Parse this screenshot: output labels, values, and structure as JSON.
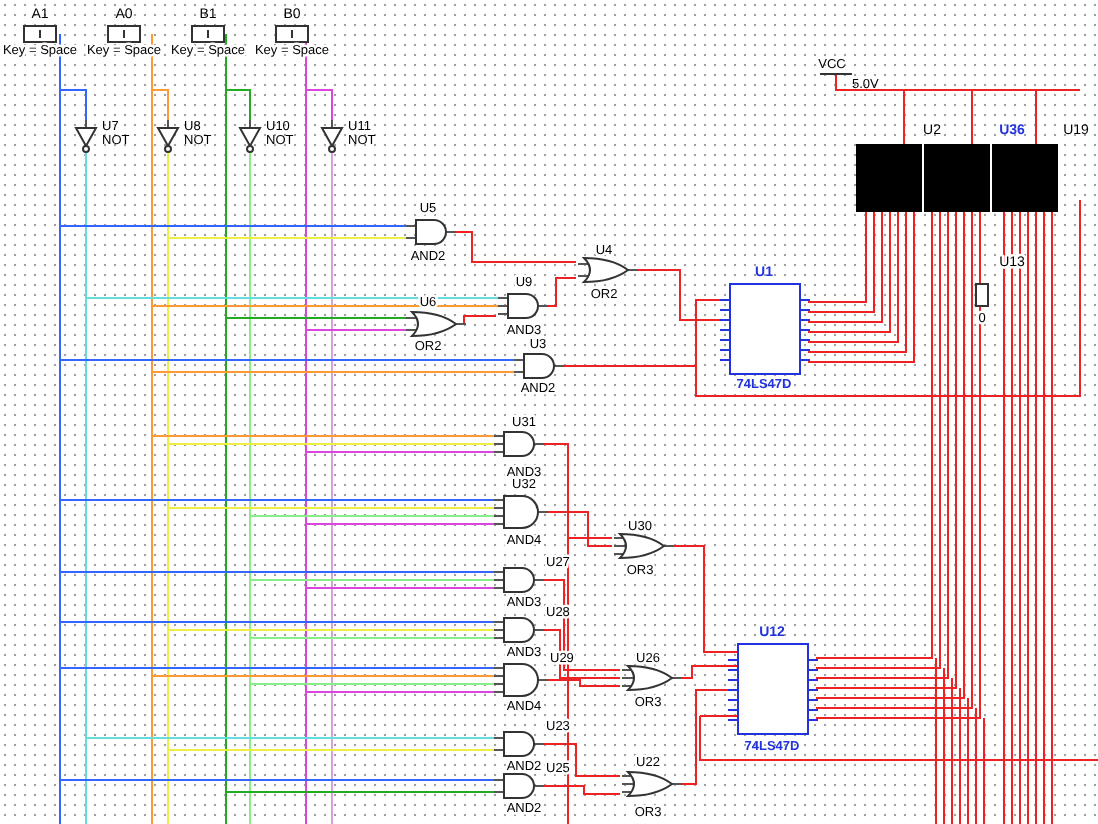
{
  "switches": [
    {
      "label": "A1",
      "key": "Key = Space",
      "color": "#3366ff"
    },
    {
      "label": "A0",
      "key": "Key = Space",
      "color": "#ff9933"
    },
    {
      "label": "B1",
      "key": "Key = Space",
      "color": "#22aa22"
    },
    {
      "label": "B0",
      "key": "Key = Space",
      "color": "#dd44dd"
    }
  ],
  "inverters": [
    {
      "ref": "U7",
      "type": "NOT",
      "color": "#66dddd"
    },
    {
      "ref": "U8",
      "type": "NOT",
      "color": "#eeee44"
    },
    {
      "ref": "U10",
      "type": "NOT",
      "color": "#88ee88"
    },
    {
      "ref": "U11",
      "type": "NOT",
      "color": "#d9a0e0"
    }
  ],
  "gates": [
    {
      "ref": "U5",
      "type": "AND2",
      "kind": "and"
    },
    {
      "ref": "U9",
      "type": "AND3",
      "kind": "and"
    },
    {
      "ref": "U6",
      "type": "OR2",
      "kind": "or"
    },
    {
      "ref": "U4",
      "type": "OR2",
      "kind": "or"
    },
    {
      "ref": "U3",
      "type": "AND2",
      "kind": "and"
    },
    {
      "ref": "U31",
      "type": "AND3",
      "kind": "and"
    },
    {
      "ref": "U32",
      "type": "AND4",
      "kind": "and"
    },
    {
      "ref": "U30",
      "type": "OR3",
      "kind": "or"
    },
    {
      "ref": "U27",
      "type": "AND3",
      "kind": "and"
    },
    {
      "ref": "U28",
      "type": "AND3",
      "kind": "and"
    },
    {
      "ref": "U29",
      "type": "AND4",
      "kind": "and"
    },
    {
      "ref": "U26",
      "type": "OR3",
      "kind": "or"
    },
    {
      "ref": "U23",
      "type": "AND2",
      "kind": "and"
    },
    {
      "ref": "U25",
      "type": "AND2",
      "kind": "and"
    },
    {
      "ref": "U22",
      "type": "OR3",
      "kind": "or"
    }
  ],
  "decoders": [
    {
      "ref": "U1",
      "type": "74LS47D"
    },
    {
      "ref": "U12",
      "type": "74LS47D"
    }
  ],
  "power": {
    "label": "VCC",
    "voltage": "5.0V"
  },
  "displays": [
    {
      "ref": "U2",
      "selected": false
    },
    {
      "ref": "U36",
      "selected": true
    },
    {
      "ref": "U19",
      "selected": false
    }
  ],
  "probe": {
    "ref": "U13",
    "value": "0"
  }
}
